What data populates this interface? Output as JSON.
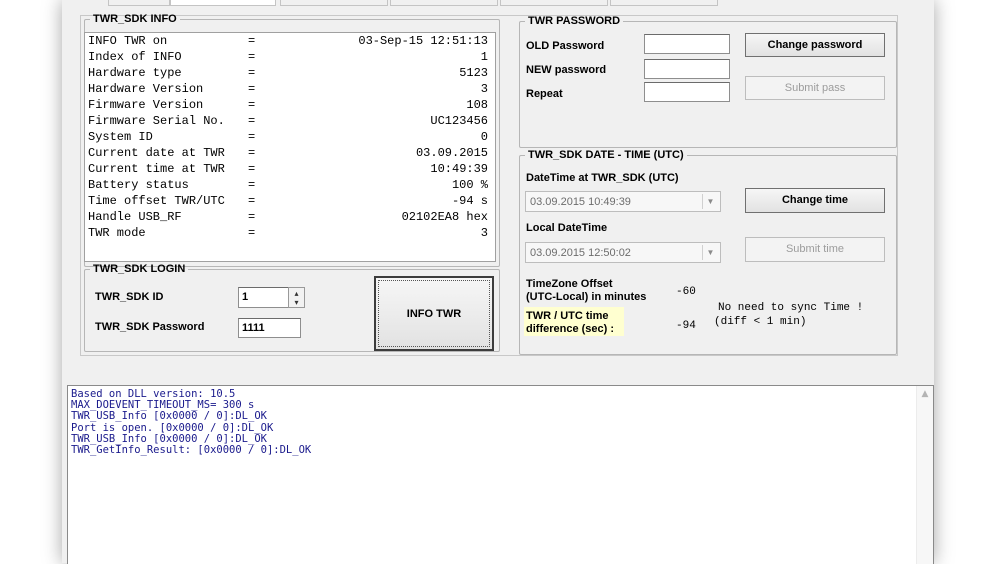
{
  "info_group": {
    "title": "TWR_SDK INFO",
    "rows": [
      {
        "label": "INFO TWR on",
        "value": "03-Sep-15 12:51:13"
      },
      {
        "label": "Index of INFO",
        "value": "1"
      },
      {
        "label": "Hardware type",
        "value": "5123"
      },
      {
        "label": "Hardware Version",
        "value": "3"
      },
      {
        "label": "Firmware Version",
        "value": "108"
      },
      {
        "label": "Firmware Serial No.",
        "value": "UC123456"
      },
      {
        "label": "System ID",
        "value": "0"
      },
      {
        "label": "Current date at TWR",
        "value": "03.09.2015"
      },
      {
        "label": "Current time at TWR",
        "value": "10:49:39"
      },
      {
        "label": "Battery status",
        "value": "100 %"
      },
      {
        "label": "Time offset TWR/UTC",
        "value": "-94 s"
      },
      {
        "label": "Handle USB_RF",
        "value": "02102EA8 hex"
      },
      {
        "label": "TWR mode",
        "value": "3"
      }
    ],
    "separator": "="
  },
  "login_group": {
    "title": "TWR_SDK LOGIN",
    "id_label": "TWR_SDK ID",
    "id_value": "1",
    "password_label": "TWR_SDK Password",
    "password_value": "1111",
    "info_button": "INFO TWR"
  },
  "password_group": {
    "title": "TWR PASSWORD",
    "old_label": "OLD Password",
    "new_label": "NEW password",
    "repeat_label": "Repeat",
    "change_button": "Change password",
    "submit_button": "Submit pass"
  },
  "datetime_group": {
    "title": "TWR_SDK DATE - TIME (UTC)",
    "twr_label": "DateTime at TWR_SDK (UTC)",
    "twr_value": "03.09.2015 10:49:39",
    "change_button": "Change time",
    "local_label": "Local DateTime",
    "local_value": "03.09.2015 12:50:02",
    "submit_button": "Submit time",
    "tz_label_1": "TimeZone Offset",
    "tz_label_2": "(UTC-Local) in minutes",
    "tz_value": "-60",
    "diff_label_1": "TWR / UTC time",
    "diff_label_2": "difference (sec) :",
    "diff_value": "-94",
    "sync_msg_1": "No need to sync Time !",
    "sync_msg_2": "(diff < 1 min)"
  },
  "log": {
    "lines": [
      "Based on DLL version: 10.5",
      "MAX_DOEVENT_TIMEOUT_MS= 300 s",
      "TWR_USB_Info [0x0000 / 0]:DL_OK",
      "Port is open. [0x0000 / 0]:DL_OK",
      "TWR_USB_Info [0x0000 / 0]:DL_OK",
      "TWR_GetInfo_Result: [0x0000 / 0]:DL_OK"
    ]
  },
  "icons": {
    "scroll_up": "chevron-up-icon",
    "dropdown": "chevron-down-icon",
    "spin": "spinner-arrows-icon"
  }
}
